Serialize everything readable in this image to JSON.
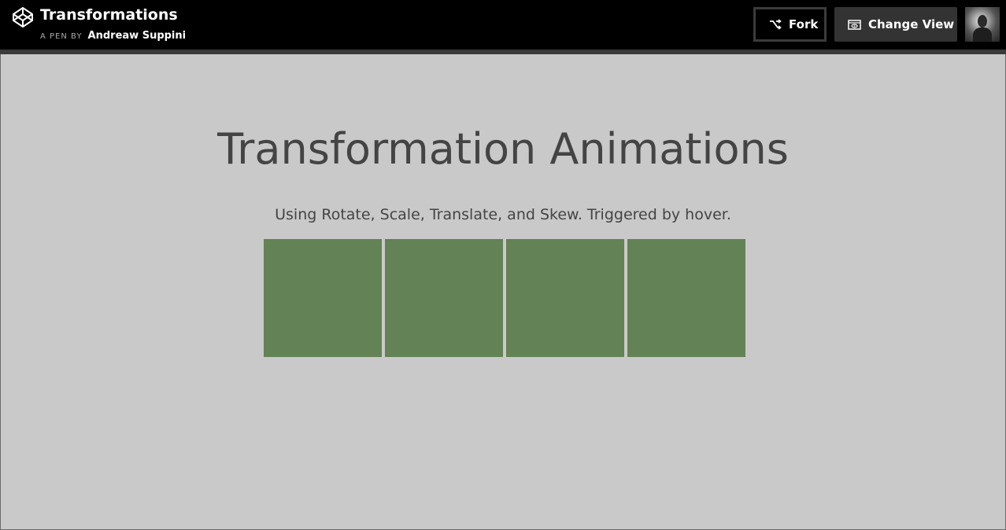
{
  "header": {
    "title": "Transformations",
    "by_label": "A PEN BY",
    "author": "Andreaw Suppini",
    "fork_label": "Fork",
    "change_view_label": "Change View",
    "logo_icon": "codepen-logo-icon",
    "fork_icon": "fork-icon",
    "change_view_icon": "eye-icon"
  },
  "preview": {
    "heading": "Transformation Animations",
    "subtitle": "Using Rotate, Scale, Translate, and Skew. Triggered by hover.",
    "box_color": "#638255",
    "boxes": [
      "rotate",
      "scale",
      "translate",
      "skew"
    ]
  },
  "colors": {
    "topbar": "#000000",
    "background": "#c9c9c9",
    "text": "#444444"
  }
}
